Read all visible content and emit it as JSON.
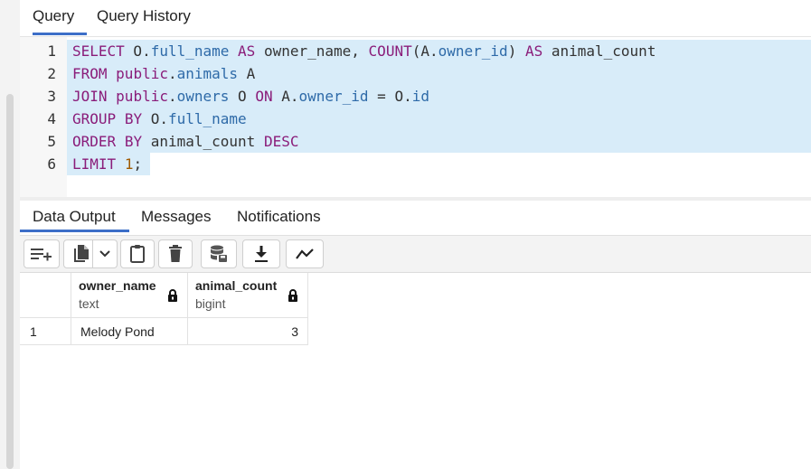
{
  "top_tabs": [
    {
      "label": "Query",
      "active": true
    },
    {
      "label": "Query History",
      "active": false
    }
  ],
  "editor": {
    "line_numbers": [
      "1",
      "2",
      "3",
      "4",
      "5",
      "6"
    ],
    "lines": [
      "SELECT O.full_name AS owner_name, COUNT(A.owner_id) AS animal_count",
      "FROM public.animals A",
      "JOIN public.owners O ON A.owner_id = O.id",
      "GROUP BY O.full_name",
      "ORDER BY animal_count DESC",
      "LIMIT 1;"
    ]
  },
  "bottom_tabs": [
    {
      "label": "Data Output",
      "active": true
    },
    {
      "label": "Messages",
      "active": false
    },
    {
      "label": "Notifications",
      "active": false
    }
  ],
  "toolbar": {
    "icons": [
      "add-row-icon",
      "copy-icon",
      "chevron-down-icon",
      "paste-icon",
      "delete-icon",
      "save-data-icon",
      "download-icon",
      "graph-icon"
    ]
  },
  "results": {
    "columns": [
      {
        "name": "owner_name",
        "type": "text"
      },
      {
        "name": "animal_count",
        "type": "bigint"
      }
    ],
    "rows": [
      {
        "row_num": "1",
        "cells": [
          "Melody Pond",
          "3"
        ]
      }
    ]
  },
  "colors": {
    "accent": "#3c6ec8",
    "selection": "#d8ecf9",
    "keyword": "#8a1d7a",
    "identifier": "#2e6aa8"
  }
}
